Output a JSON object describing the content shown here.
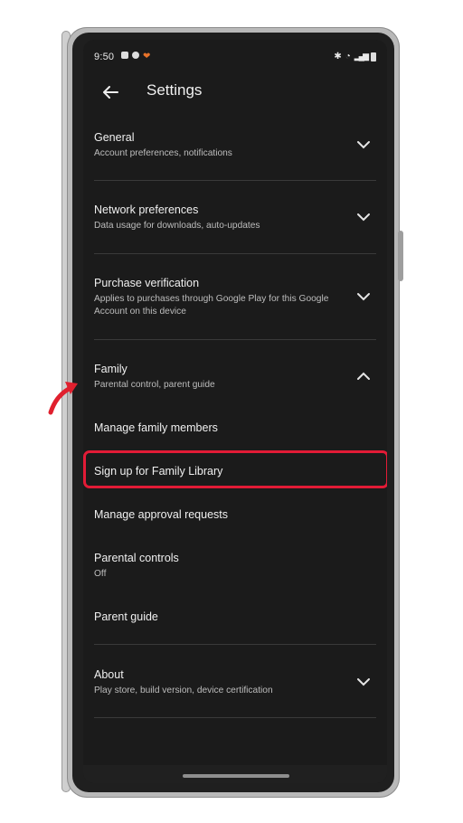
{
  "status": {
    "time": "9:50"
  },
  "header": {
    "title": "Settings"
  },
  "items": {
    "general": {
      "label": "General",
      "sub": "Account preferences, notifications"
    },
    "network": {
      "label": "Network preferences",
      "sub": "Data usage for downloads, auto-updates"
    },
    "purchase": {
      "label": "Purchase verification",
      "sub": "Applies to purchases through Google Play for this Google Account on this device"
    },
    "family": {
      "label": "Family",
      "sub": "Parental control, parent guide"
    },
    "family_children": [
      {
        "label": "Manage family members"
      },
      {
        "label": "Sign up for Family Library"
      },
      {
        "label": "Manage approval requests"
      },
      {
        "label": "Parental controls",
        "sub": "Off"
      },
      {
        "label": "Parent guide"
      }
    ],
    "about": {
      "label": "About",
      "sub": "Play store, build version, device certification"
    }
  },
  "colors": {
    "background": "#1b1b1b",
    "highlight": "#e21b36",
    "text": "#f0f0f0"
  }
}
